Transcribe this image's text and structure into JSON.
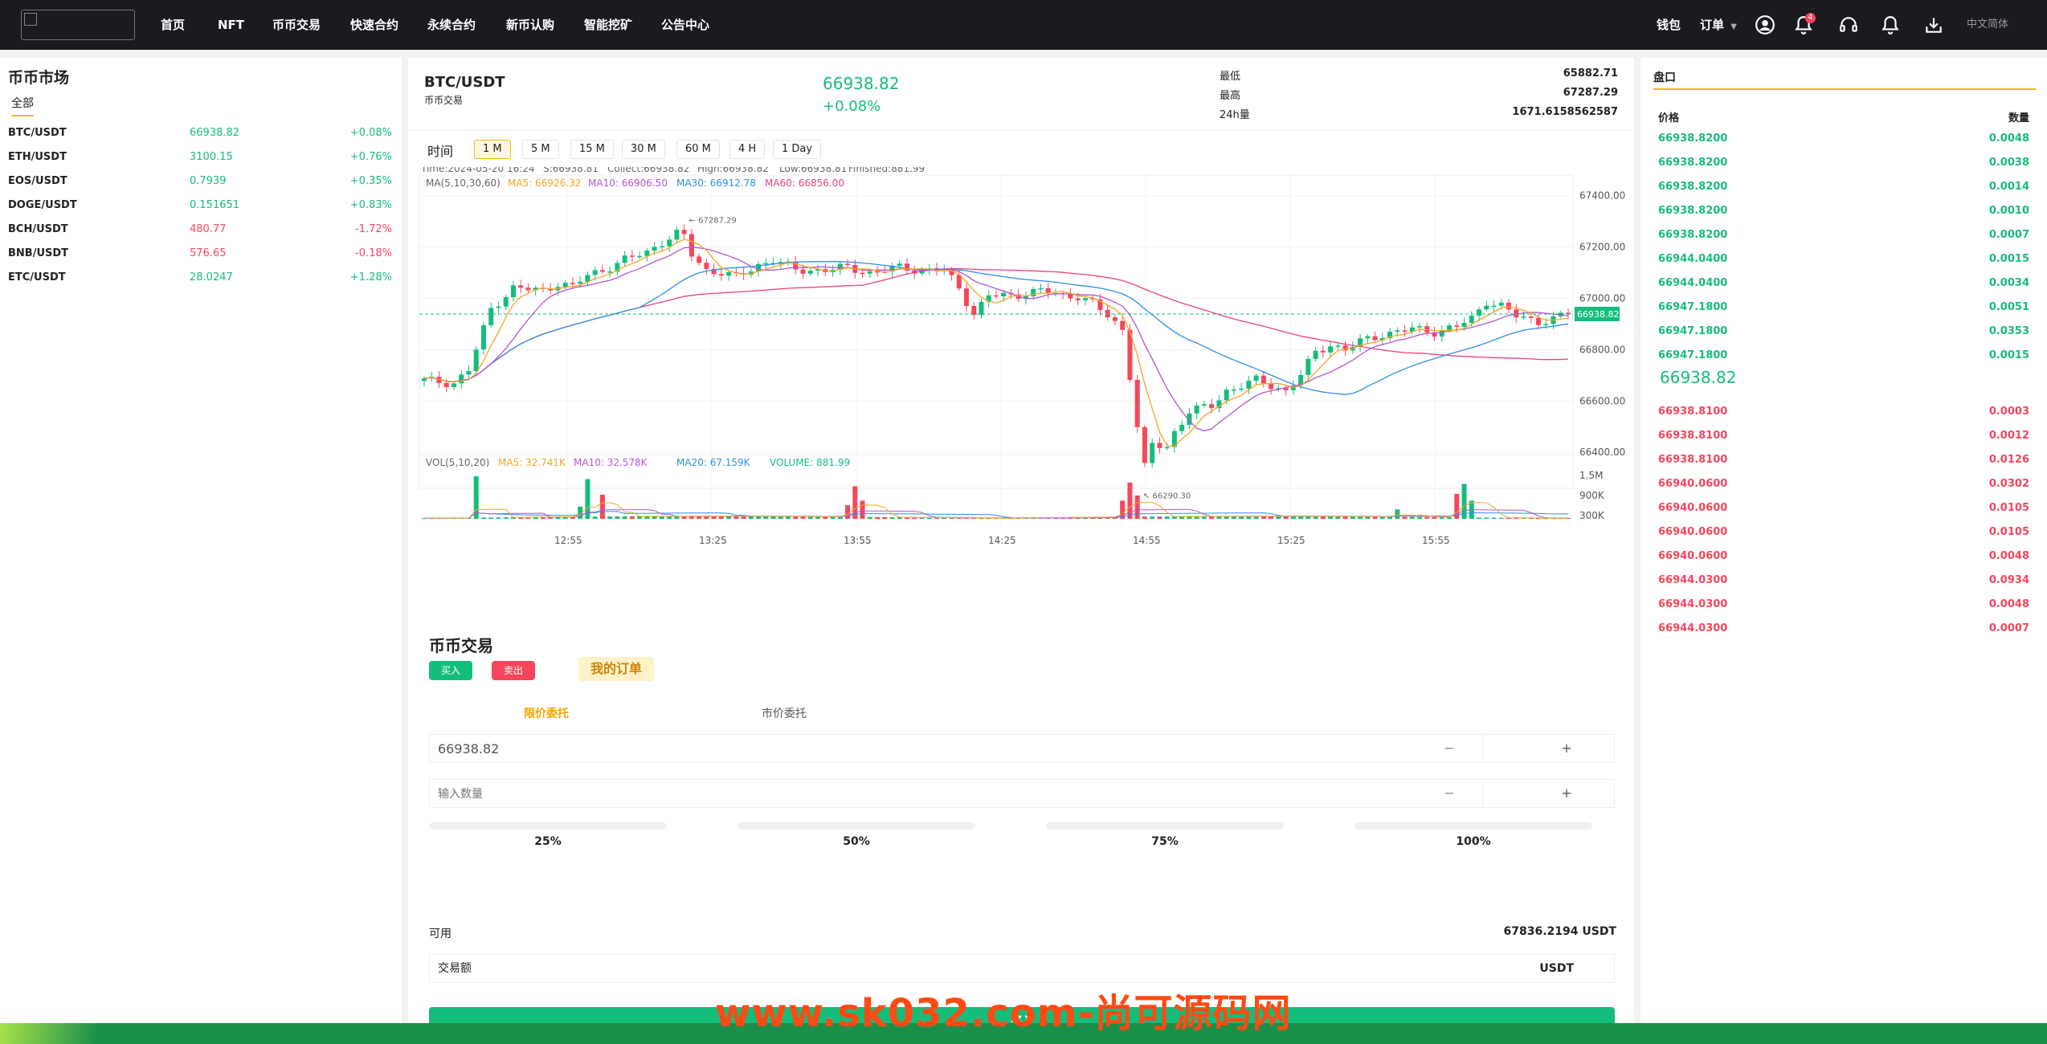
{
  "nav": {
    "items": [
      "首页",
      "NFT",
      "币币交易",
      "快速合约",
      "永续合约",
      "新币认购",
      "智能挖矿",
      "公告中心"
    ],
    "wallet": "钱包",
    "orders": "订单",
    "notification_count": "4",
    "language": "中文简体"
  },
  "market": {
    "title": "币币市场",
    "tab_all": "全部",
    "rows": [
      {
        "symbol": "BTC/USDT",
        "price": "66938.82",
        "change": "+0.08%",
        "dir": "up"
      },
      {
        "symbol": "ETH/USDT",
        "price": "3100.15",
        "change": "+0.76%",
        "dir": "up"
      },
      {
        "symbol": "EOS/USDT",
        "price": "0.7939",
        "change": "+0.35%",
        "dir": "up"
      },
      {
        "symbol": "DOGE/USDT",
        "price": "0.151651",
        "change": "+0.83%",
        "dir": "up"
      },
      {
        "symbol": "BCH/USDT",
        "price": "480.77",
        "change": "-1.72%",
        "dir": "down"
      },
      {
        "symbol": "BNB/USDT",
        "price": "576.65",
        "change": "-0.18%",
        "dir": "down"
      },
      {
        "symbol": "ETC/USDT",
        "price": "28.0247",
        "change": "+1.28%",
        "dir": "up"
      }
    ]
  },
  "ticker": {
    "pair": "BTC/USDT",
    "subtitle": "币币交易",
    "last": "66938.82",
    "change": "+0.08%",
    "low_label": "最低",
    "low": "65882.71",
    "high_label": "最高",
    "high": "67287.29",
    "vol_label": "24h量",
    "vol": "1671.6158562587"
  },
  "intervals": {
    "label": "时间",
    "options": [
      "1 M",
      "5 M",
      "15 M",
      "30 M",
      "60 M",
      "4 H",
      "1 Day"
    ],
    "active": "1 M"
  },
  "chart_info": {
    "time": "Time:2024-05-20 16:24",
    "open": "S:66938.81",
    "close": "Collect:66938.82",
    "high": "High:66938.82",
    "low": "Low:66938.81",
    "volume": "Finished:881.99",
    "ma_label": "MA(5,10,30,60)",
    "ma5": "MA5: 66926.32",
    "ma10": "MA10: 66906.50",
    "ma30": "MA30: 66912.78",
    "ma60": "MA60: 66856.00",
    "vol_label": "VOL(5,10,20)",
    "vma5": "MA5: 32.741K",
    "vma10": "MA10: 32.578K",
    "vma20": "MA20: 67.159K",
    "vcur": "VOLUME: 881.99",
    "max_label": "67287.29",
    "min_label": "66290.30",
    "last_tag": "66938.82"
  },
  "chart_data": {
    "type": "candlestick",
    "y_ticks": [
      67400,
      67200,
      67000,
      66800,
      66600,
      66400
    ],
    "y_tick_labels": [
      "67400.00",
      "67200.00",
      "67000.00",
      "66800.00",
      "66600.00",
      "66400.00"
    ],
    "vol_ticks": [
      "1.5M",
      "900K",
      "300K"
    ],
    "x_ticks": [
      "12:55",
      "13:25",
      "13:55",
      "14:25",
      "14:55",
      "15:25",
      "15:55"
    ],
    "ylim": [
      66260,
      67480
    ],
    "vol_max": 1700,
    "close_path": [
      [
        0,
        66680
      ],
      [
        4,
        66670
      ],
      [
        6,
        66720
      ],
      [
        9,
        66960
      ],
      [
        12,
        67040
      ],
      [
        16,
        67030
      ],
      [
        18,
        67060
      ],
      [
        20,
        67045
      ],
      [
        22,
        67090
      ],
      [
        24,
        67110
      ],
      [
        27,
        67150
      ],
      [
        30,
        67180
      ],
      [
        32,
        67220
      ],
      [
        34,
        67250
      ],
      [
        35,
        67240
      ],
      [
        36,
        67170
      ],
      [
        38,
        67110
      ],
      [
        40,
        67100
      ],
      [
        42,
        67080
      ],
      [
        45,
        67130
      ],
      [
        47,
        67150
      ],
      [
        50,
        67110
      ],
      [
        54,
        67110
      ],
      [
        57,
        67120
      ],
      [
        60,
        67100
      ],
      [
        64,
        67120
      ],
      [
        67,
        67110
      ],
      [
        70,
        67110
      ],
      [
        72,
        67040
      ],
      [
        74,
        66940
      ],
      [
        76,
        67010
      ],
      [
        79,
        67010
      ],
      [
        83,
        67030
      ],
      [
        86,
        67010
      ],
      [
        88,
        67010
      ],
      [
        90,
        66980
      ],
      [
        92,
        66930
      ],
      [
        94,
        66880
      ],
      [
        95,
        66700
      ],
      [
        96,
        66500
      ],
      [
        97,
        66340
      ],
      [
        98,
        66430
      ],
      [
        100,
        66420
      ],
      [
        101,
        66480
      ],
      [
        103,
        66560
      ],
      [
        106,
        66580
      ],
      [
        108,
        66640
      ],
      [
        110,
        66660
      ],
      [
        112,
        66680
      ],
      [
        114,
        66660
      ],
      [
        116,
        66640
      ],
      [
        118,
        66700
      ],
      [
        120,
        66790
      ],
      [
        122,
        66820
      ],
      [
        124,
        66800
      ],
      [
        126,
        66830
      ],
      [
        129,
        66860
      ],
      [
        131,
        66870
      ],
      [
        133,
        66880
      ],
      [
        136,
        66870
      ],
      [
        139,
        66890
      ],
      [
        141,
        66920
      ],
      [
        143,
        66990
      ],
      [
        145,
        66970
      ],
      [
        147,
        66930
      ],
      [
        150,
        66910
      ],
      [
        152,
        66920
      ],
      [
        154,
        66938.82
      ]
    ],
    "volume_spikes": [
      [
        7,
        1500
      ],
      [
        21,
        430
      ],
      [
        22,
        1400
      ],
      [
        24,
        850
      ],
      [
        57,
        480
      ],
      [
        58,
        1150
      ],
      [
        59,
        640
      ],
      [
        94,
        640
      ],
      [
        95,
        1280
      ],
      [
        96,
        820
      ],
      [
        131,
        330
      ],
      [
        139,
        880
      ],
      [
        140,
        1230
      ],
      [
        141,
        640
      ]
    ]
  },
  "trade": {
    "title": "币币交易",
    "buy": "买入",
    "sell": "卖出",
    "my_orders": "我的订单",
    "limit": "限价委托",
    "market": "市价委托",
    "price_value": "66938.82",
    "qty_placeholder": "输入数量",
    "minus": "−",
    "plus": "+",
    "pcts": [
      "25%",
      "50%",
      "75%",
      "100%"
    ],
    "available_label": "可用",
    "available": "67836.2194 USDT",
    "amount_label": "交易额",
    "amount_unit": "USDT",
    "submit": "买入"
  },
  "orderbook": {
    "title": "盘口",
    "price_header": "价格",
    "qty_header": "数量",
    "bids": [
      {
        "price": "66938.8200",
        "qty": "0.0048"
      },
      {
        "price": "66938.8200",
        "qty": "0.0038"
      },
      {
        "price": "66938.8200",
        "qty": "0.0014"
      },
      {
        "price": "66938.8200",
        "qty": "0.0010"
      },
      {
        "price": "66938.8200",
        "qty": "0.0007"
      },
      {
        "price": "66944.0400",
        "qty": "0.0015"
      },
      {
        "price": "66944.0400",
        "qty": "0.0034"
      },
      {
        "price": "66947.1800",
        "qty": "0.0051"
      },
      {
        "price": "66947.1800",
        "qty": "0.0353"
      },
      {
        "price": "66947.1800",
        "qty": "0.0015"
      }
    ],
    "mid": "66938.82",
    "asks": [
      {
        "price": "66938.8100",
        "qty": "0.0003"
      },
      {
        "price": "66938.8100",
        "qty": "0.0012"
      },
      {
        "price": "66938.8100",
        "qty": "0.0126"
      },
      {
        "price": "66940.0600",
        "qty": "0.0302"
      },
      {
        "price": "66940.0600",
        "qty": "0.0105"
      },
      {
        "price": "66940.0600",
        "qty": "0.0105"
      },
      {
        "price": "66940.0600",
        "qty": "0.0048"
      },
      {
        "price": "66944.0300",
        "qty": "0.0934"
      },
      {
        "price": "66944.0300",
        "qty": "0.0048"
      },
      {
        "price": "66944.0300",
        "qty": "0.0007"
      }
    ]
  },
  "colors": {
    "up": "#15bd7b",
    "down": "#f5465c",
    "ma5": "#f5a623",
    "ma10": "#b455d6",
    "ma30": "#2e8ee6",
    "ma60": "#e8437a",
    "accent": "#f0b90b"
  },
  "watermark": "www.sk032.com-尚可源码网"
}
